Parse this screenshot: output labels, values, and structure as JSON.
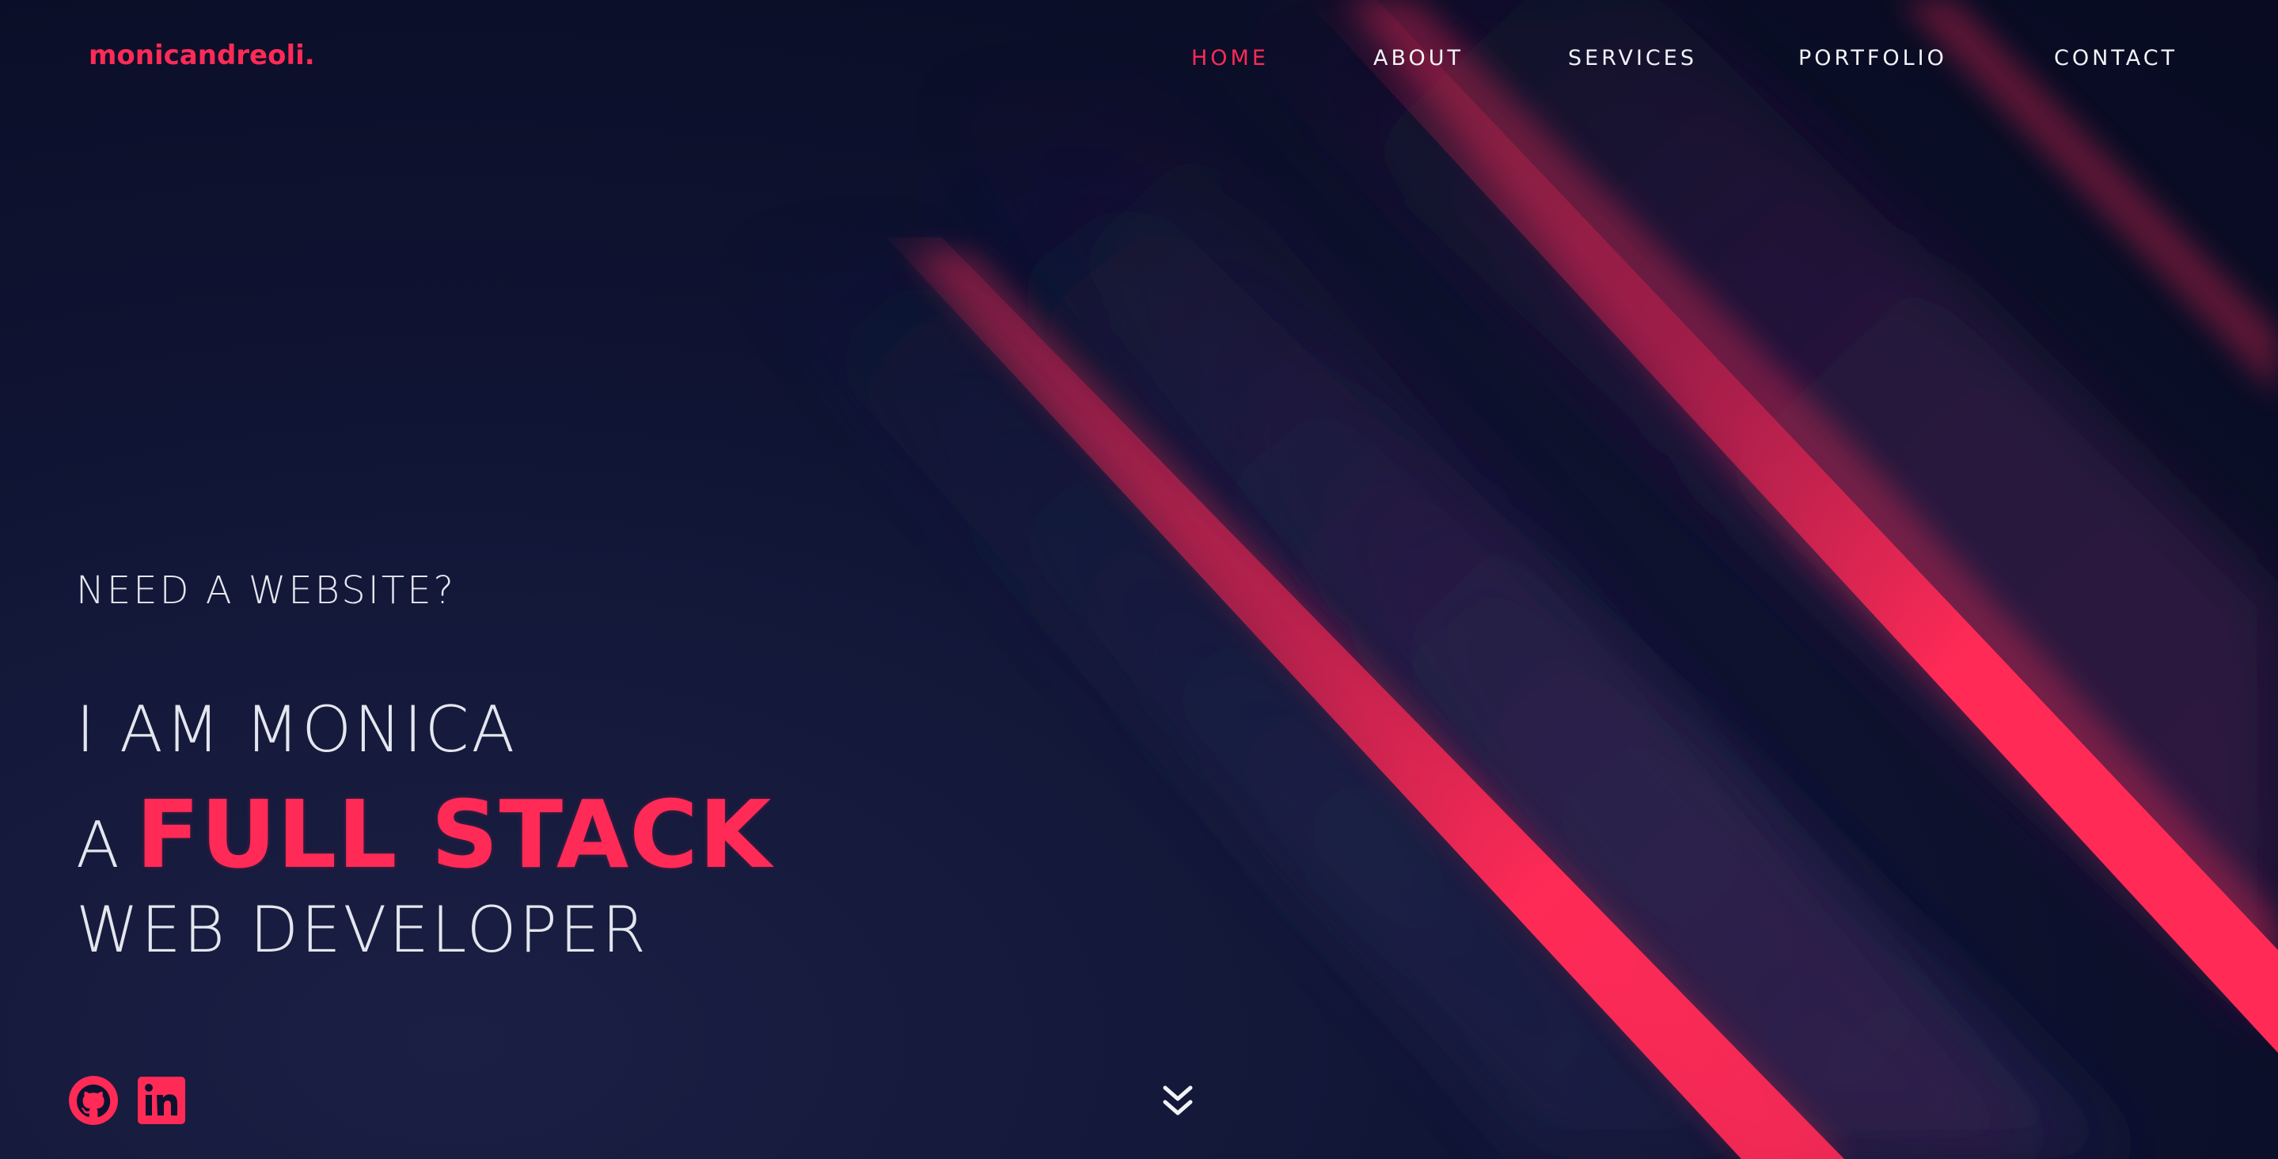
{
  "brand": {
    "logo_text": "monicandreoli.",
    "accent_color": "#ff2a56",
    "background_color": "#0b1029"
  },
  "nav": {
    "items": [
      {
        "label": "HOME",
        "active": true
      },
      {
        "label": "ABOUT",
        "active": false
      },
      {
        "label": "SERVICES",
        "active": false
      },
      {
        "label": "PORTFOLIO",
        "active": false
      },
      {
        "label": "CONTACT",
        "active": false
      }
    ]
  },
  "hero": {
    "tagline": "NEED A WEBSITE?",
    "line1": "I AM MONICA",
    "line2_prefix": "A",
    "line2_highlight": "FULL STACK",
    "line3": "WEB DEVELOPER"
  },
  "social": {
    "icons": [
      "github-icon",
      "linkedin-icon"
    ]
  },
  "scroll": {
    "icon": "chevrons-down-icon"
  }
}
